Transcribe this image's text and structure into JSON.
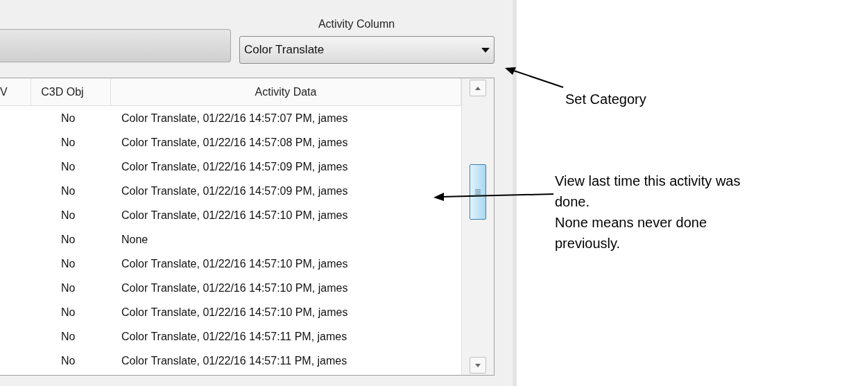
{
  "activity_column": {
    "label": "Activity Column",
    "dropdown": {
      "value": "Color Translate"
    }
  },
  "table": {
    "columns": [
      "V",
      "C3D Obj",
      "Activity Data"
    ],
    "rows": [
      {
        "column_1": "",
        "c3d_obj": "No",
        "activity_data": "Color Translate, 01/22/16 14:57:07 PM, james"
      },
      {
        "column_1": "",
        "c3d_obj": "No",
        "activity_data": "Color Translate, 01/22/16 14:57:08 PM, james"
      },
      {
        "column_1": "",
        "c3d_obj": "No",
        "activity_data": "Color Translate, 01/22/16 14:57:09 PM, james"
      },
      {
        "column_1": "",
        "c3d_obj": "No",
        "activity_data": "Color Translate, 01/22/16 14:57:09 PM, james"
      },
      {
        "column_1": "",
        "c3d_obj": "No",
        "activity_data": "Color Translate, 01/22/16 14:57:10 PM, james"
      },
      {
        "column_1": "",
        "c3d_obj": "No",
        "activity_data": "None"
      },
      {
        "column_1": "",
        "c3d_obj": "No",
        "activity_data": "Color Translate, 01/22/16 14:57:10 PM, james"
      },
      {
        "column_1": "",
        "c3d_obj": "No",
        "activity_data": "Color Translate, 01/22/16 14:57:10 PM, james"
      },
      {
        "column_1": "",
        "c3d_obj": "No",
        "activity_data": "Color Translate, 01/22/16 14:57:10 PM, james"
      },
      {
        "column_1": "",
        "c3d_obj": "No",
        "activity_data": "Color Translate, 01/22/16 14:57:11 PM, james"
      },
      {
        "column_1": "",
        "c3d_obj": "No",
        "activity_data": "Color Translate, 01/22/16 14:57:11 PM, james"
      }
    ]
  },
  "annotations": [
    {
      "lines": [
        "Set Category"
      ]
    },
    {
      "lines": [
        "View last time this activity was",
        "done.",
        "None means never done",
        "previously."
      ]
    }
  ]
}
